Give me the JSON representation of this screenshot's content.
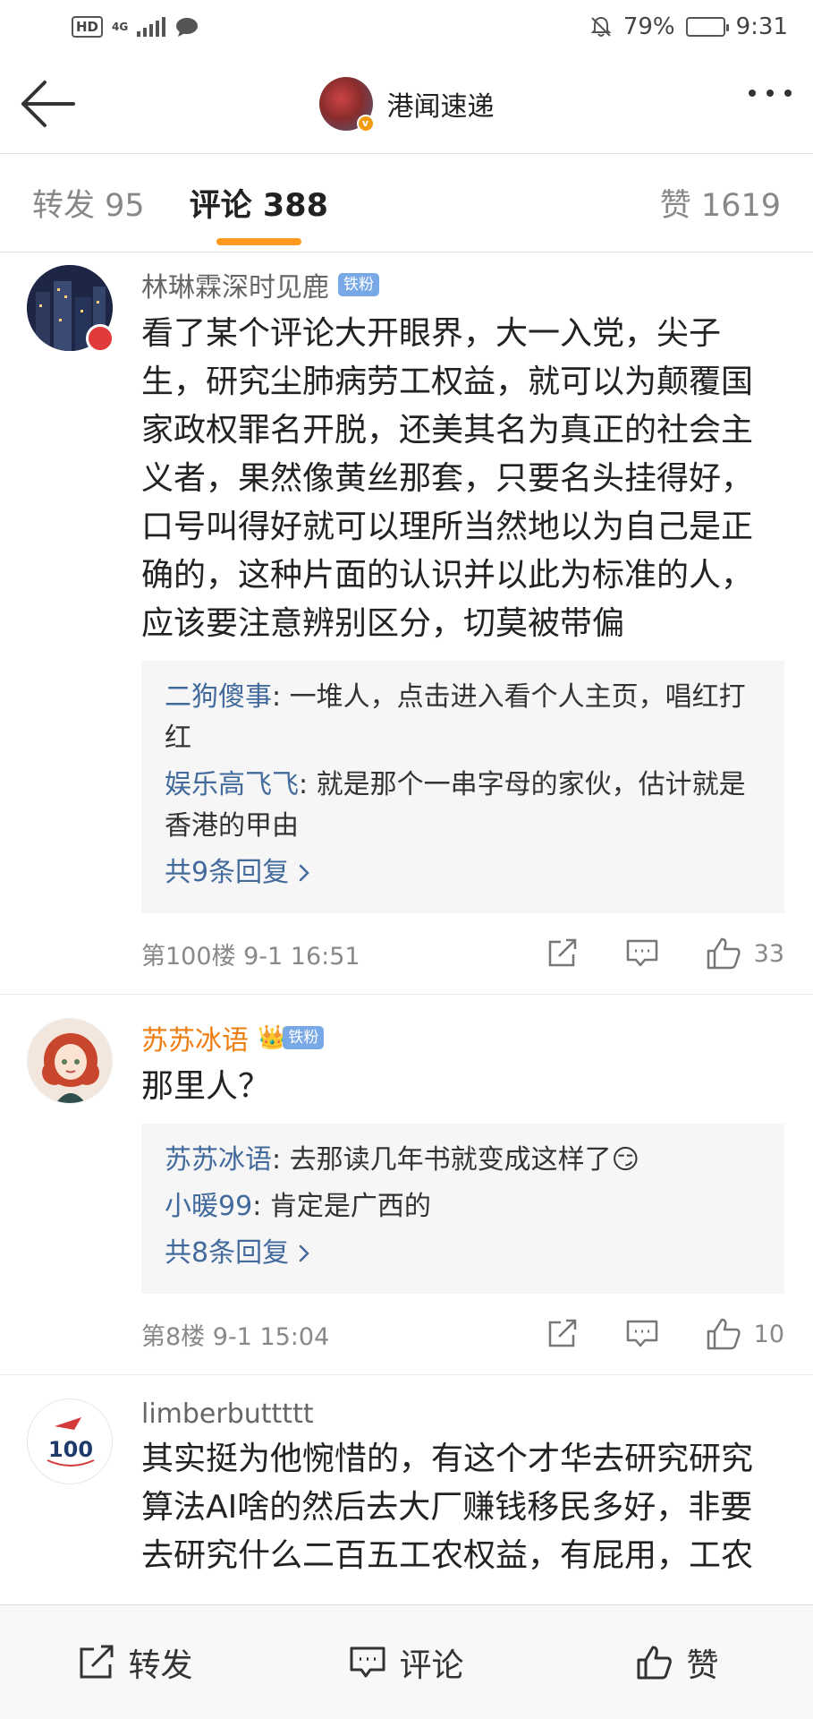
{
  "status_bar": {
    "hd": "HD",
    "network": "4G",
    "battery_percent": "79%",
    "battery_level": 0.79,
    "time": "9:31"
  },
  "nav": {
    "title": "港闻速递",
    "back_icon": "back-arrow-icon",
    "more_icon": "more-icon"
  },
  "tabs": [
    {
      "label": "转发 95"
    },
    {
      "label": "评论 388"
    },
    {
      "label": "赞 1619"
    }
  ],
  "comments": [
    {
      "user": "林琳霖深时见鹿",
      "badge": "铁粉",
      "text": "看了某个评论大开眼界，大一入党，尖子生，研究尘肺病劳工权益，就可以为颠覆国家政权罪名开脱，还美其名为真正的社会主义者，果然像黄丝那套，只要名头挂得好，口号叫得好就可以理所当然地以为自己是正确的，这种片面的认识并以此为标准的人，应该要注意辨别区分，切莫被带偏",
      "replies": [
        {
          "user": "二狗傻事",
          "text": ": 一堆人，点击进入看个人主页，唱红打红"
        },
        {
          "user": "娱乐高飞飞",
          "text": ": 就是那个一串字母的家伙，估计就是香港的甲由"
        }
      ],
      "all_replies": "共9条回复",
      "floor_time": "第100楼  9-1 16:51",
      "likes": "33"
    },
    {
      "user": "苏苏冰语",
      "badge": "铁粉",
      "text": "那里人？",
      "replies": [
        {
          "user": "苏苏冰语",
          "text": ": 去那读几年书就变成这样了😏"
        },
        {
          "user": "小暖99",
          "text": ": 肯定是广西的"
        }
      ],
      "all_replies": "共8条回复",
      "floor_time": "第8楼  9-1 15:04",
      "likes": "10"
    },
    {
      "user": "limberbuttttt",
      "text": "其实挺为他惋惜的，有这个才华去研究研究算法AI啥的然后去大厂赚钱移民多好，非要去研究什么二百五工农权益，有屁用，工农"
    }
  ],
  "bottom_bar": {
    "repost": "转发",
    "comment": "评论",
    "like": "赞"
  },
  "colors": {
    "accent_orange": "#ff9a1f",
    "link_blue": "#436a9c",
    "vip_orange": "#ee7d11"
  }
}
